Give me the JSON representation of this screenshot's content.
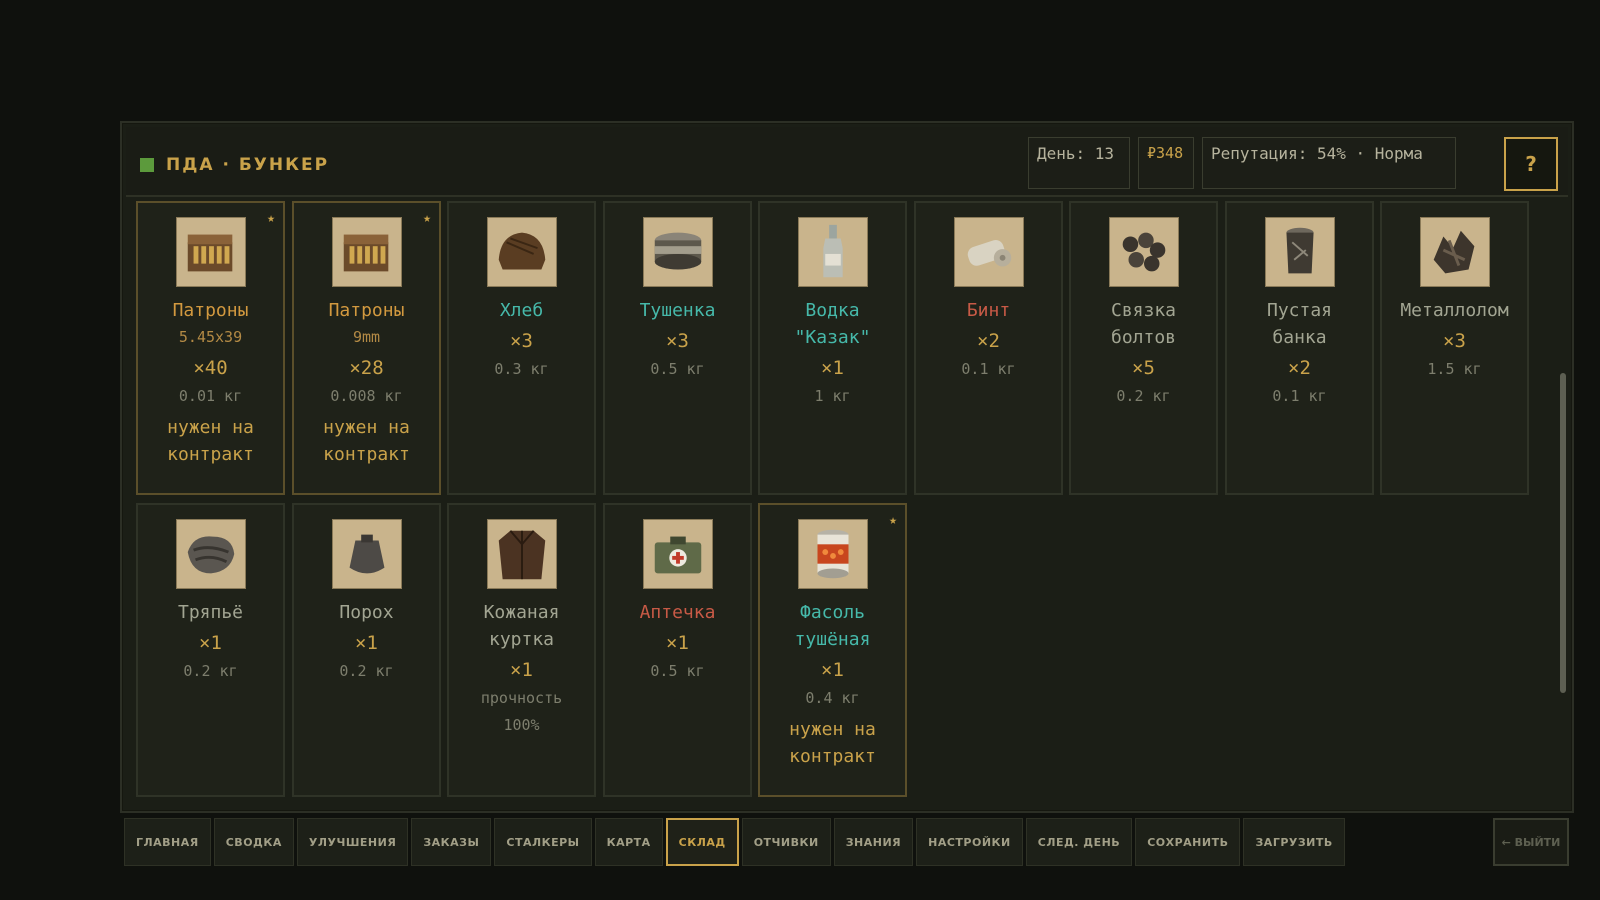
{
  "header": {
    "title": "ПДА · БУНКЕР",
    "day": "День: 13",
    "money": "₽348",
    "reputation": "Репутация: 54% · Норма",
    "help": "?"
  },
  "items": [
    {
      "name": "Патроны",
      "sub": "5.45x39",
      "qty": "×40",
      "weight": "0.01 кг",
      "contract": "нужен на контракт",
      "starred": true,
      "name_color": "orange",
      "icon": "ammo-box-icon"
    },
    {
      "name": "Патроны",
      "sub": "9mm",
      "qty": "×28",
      "weight": "0.008 кг",
      "contract": "нужен на контракт",
      "starred": true,
      "name_color": "orange",
      "icon": "ammo-box-icon"
    },
    {
      "name": "Хлеб",
      "qty": "×3",
      "weight": "0.3 кг",
      "name_color": "cyan",
      "icon": "bread-icon"
    },
    {
      "name": "Тушенка",
      "qty": "×3",
      "weight": "0.5 кг",
      "name_color": "cyan",
      "icon": "canned-meat-icon"
    },
    {
      "name": "Водка \"Казак\"",
      "qty": "×1",
      "weight": "1 кг",
      "name_color": "cyan",
      "icon": "vodka-bottle-icon"
    },
    {
      "name": "Бинт",
      "qty": "×2",
      "weight": "0.1 кг",
      "name_color": "red",
      "icon": "bandage-icon"
    },
    {
      "name": "Связка болтов",
      "qty": "×5",
      "weight": "0.2 кг",
      "name_color": "gray",
      "icon": "bolts-icon"
    },
    {
      "name": "Пустая банка",
      "qty": "×2",
      "weight": "0.1 кг",
      "name_color": "gray",
      "icon": "empty-can-icon"
    },
    {
      "name": "Металлолом",
      "qty": "×3",
      "weight": "1.5 кг",
      "name_color": "gray",
      "icon": "scrap-metal-icon"
    },
    {
      "name": "Тряпьё",
      "qty": "×1",
      "weight": "0.2 кг",
      "name_color": "gray",
      "icon": "rags-icon"
    },
    {
      "name": "Порох",
      "qty": "×1",
      "weight": "0.2 кг",
      "name_color": "gray",
      "icon": "gunpowder-bag-icon"
    },
    {
      "name": "Кожаная куртка",
      "qty": "×1",
      "extra": "прочность 100%",
      "name_color": "gray",
      "icon": "leather-jacket-icon"
    },
    {
      "name": "Аптечка",
      "qty": "×1",
      "weight": "0.5 кг",
      "name_color": "red",
      "icon": "medkit-icon"
    },
    {
      "name": "Фасоль тушёная",
      "qty": "×1",
      "weight": "0.4 кг",
      "contract": "нужен на контракт",
      "starred": true,
      "name_color": "cyan",
      "icon": "bean-can-icon"
    }
  ],
  "nav": [
    {
      "label": "ГЛАВНАЯ"
    },
    {
      "label": "СВОДКА"
    },
    {
      "label": "УЛУЧШЕНИЯ"
    },
    {
      "label": "ЗАКАЗЫ"
    },
    {
      "label": "СТАЛКЕРЫ"
    },
    {
      "label": "КАРТА"
    },
    {
      "label": "СКЛАД",
      "active": true
    },
    {
      "label": "ОТЧИВКИ"
    },
    {
      "label": "ЗНАНИЯ"
    },
    {
      "label": "НАСТРОЙКИ"
    },
    {
      "label": "СЛЕД. ДЕНЬ"
    },
    {
      "label": "СОХРАНИТЬ"
    },
    {
      "label": "ЗАГРУЗИТЬ"
    }
  ],
  "exit_label": "← ВЫЙТИ",
  "colors": {
    "accent": "#c9a24a",
    "orange": "#d2993f",
    "cyan": "#46b9aa",
    "red": "#c85a46",
    "gray": "#a2a592"
  }
}
